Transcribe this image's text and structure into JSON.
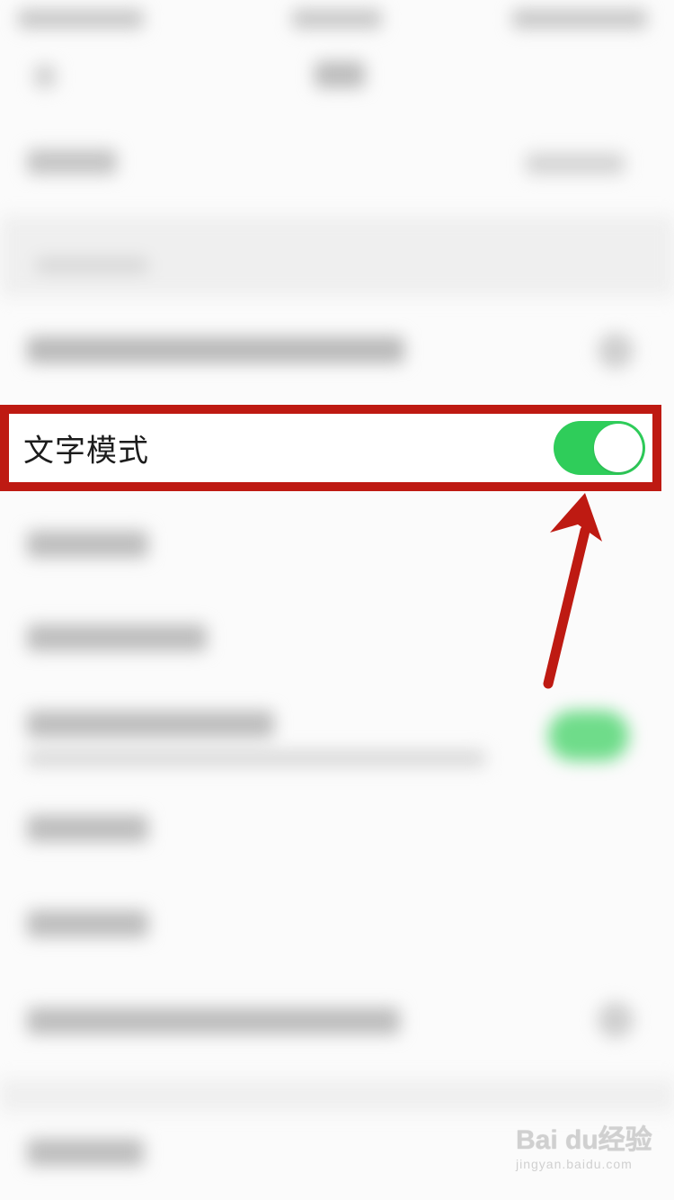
{
  "settings_row": {
    "label": "文字模式",
    "toggle_on": true
  },
  "watermark": {
    "logo": "Bai du经验",
    "url": "jingyan.baidu.com"
  },
  "colors": {
    "highlight_border": "#be1a12",
    "toggle_on": "#2fcd5a",
    "arrow": "#be1a12"
  }
}
